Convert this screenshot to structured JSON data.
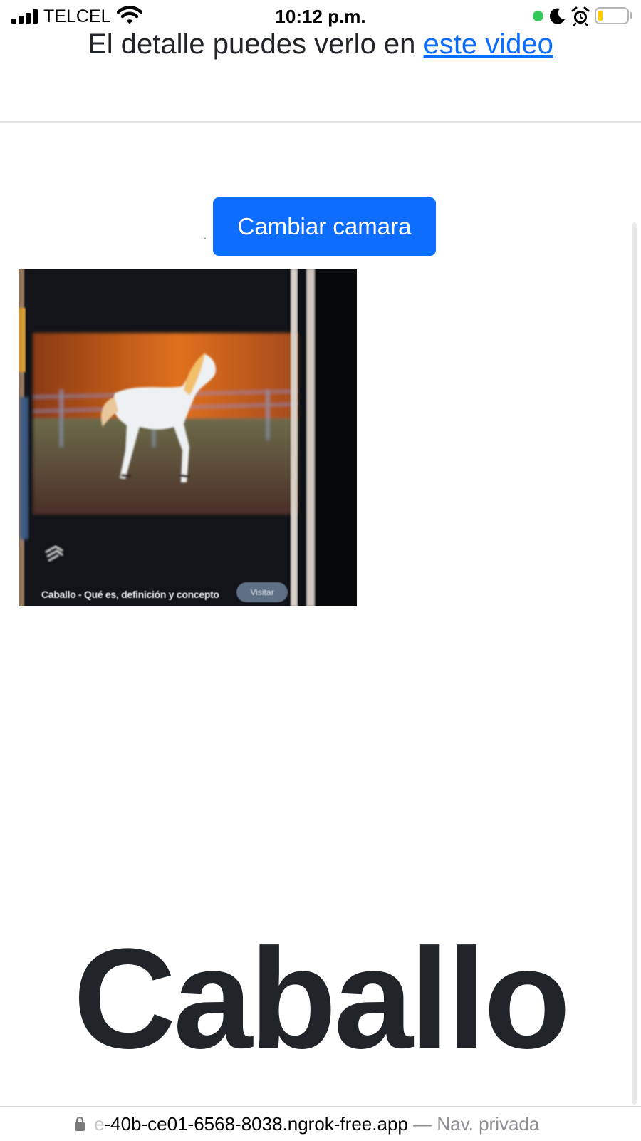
{
  "status_bar": {
    "carrier": "TELCEL",
    "time": "10:12 p.m.",
    "signal_bars": 4,
    "battery_level": 0.15,
    "camera_in_use_color": "#34c759"
  },
  "intro": {
    "text": "El detalle puedes verlo en ",
    "link_text": "este video"
  },
  "switch_camera_button": {
    "label": "Cambiar camara"
  },
  "camera_feed": {
    "caption": "Caballo - Qué es, definición y concepto",
    "visit_label": "Visitar"
  },
  "prediction": {
    "label": "Caballo"
  },
  "url_bar": {
    "domain_fade": "e",
    "domain": "-40b-ce01-6568-8038.ngrok-free.app",
    "separator": " — ",
    "mode": "Nav. privada"
  },
  "colors": {
    "accent": "#0d6efd",
    "text": "#212529",
    "divider": "#dee2e6"
  }
}
